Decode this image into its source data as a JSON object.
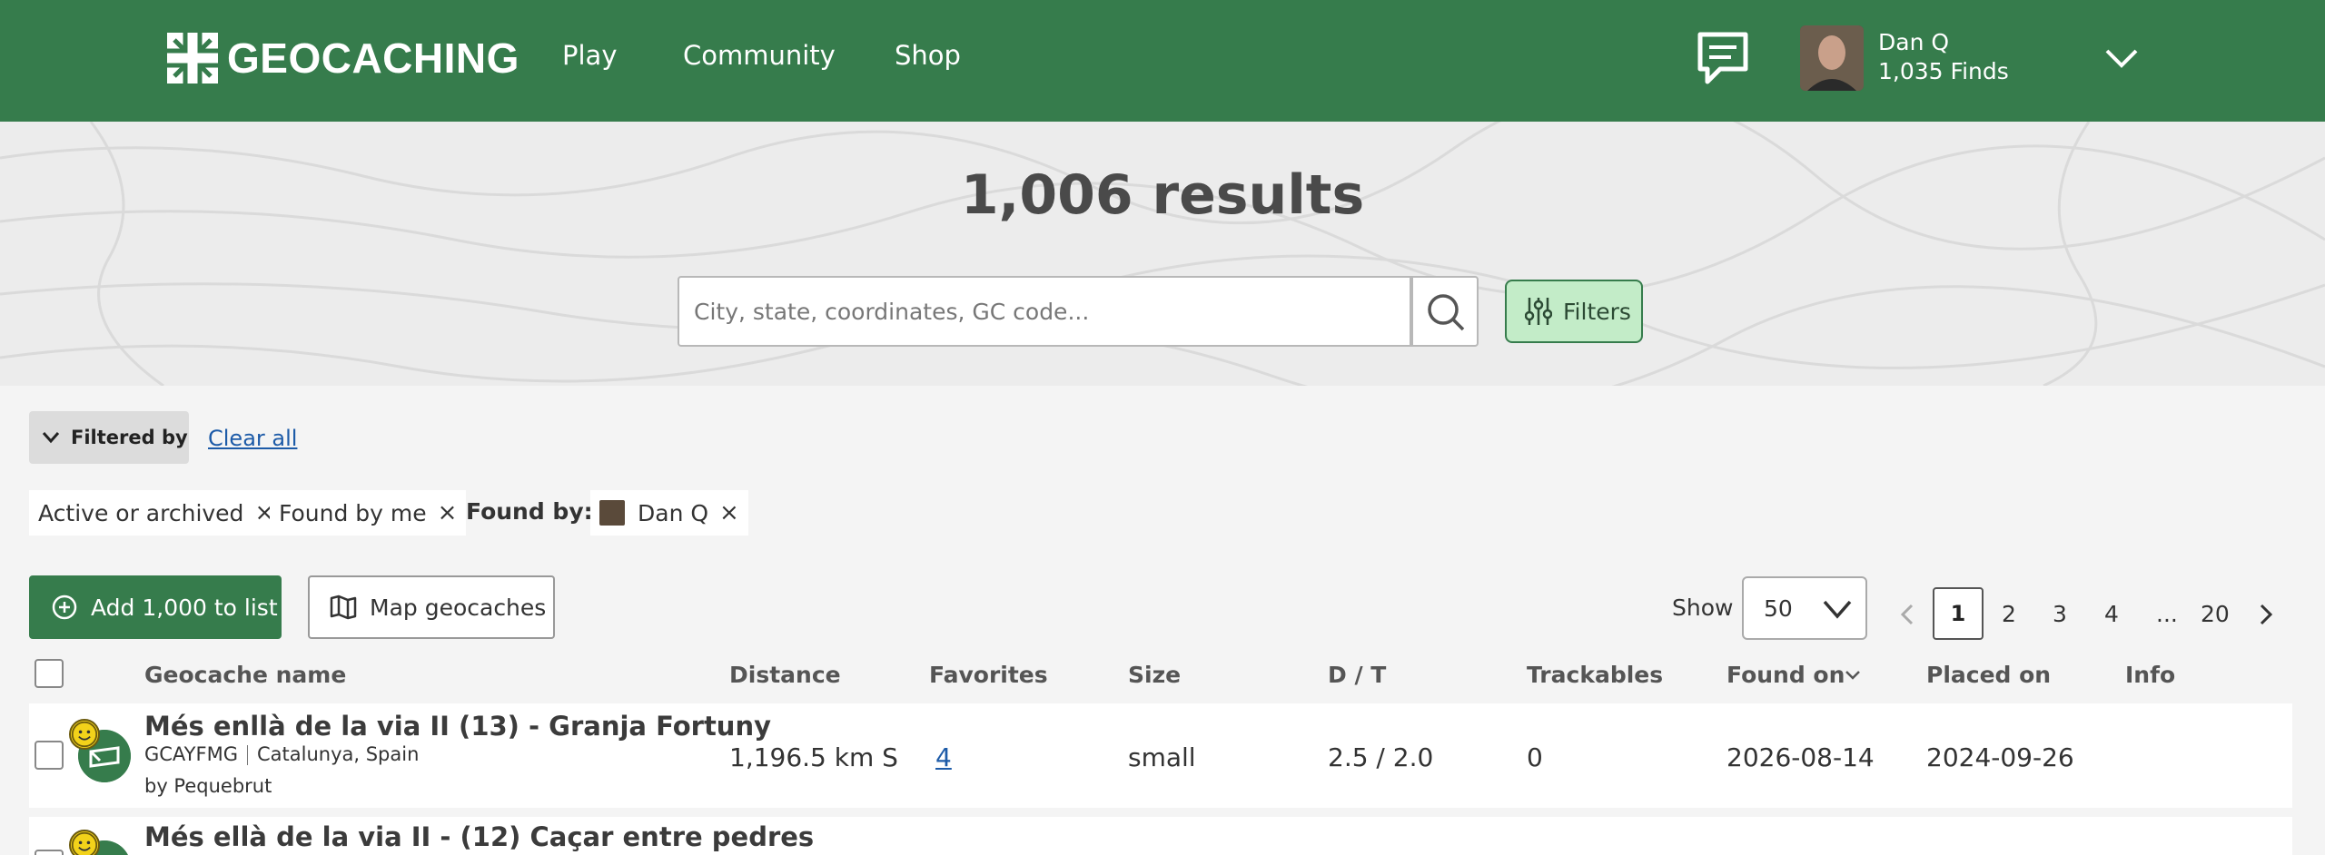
{
  "header": {
    "logo_text": "GEOCACHING",
    "nav": [
      "Play",
      "Community",
      "Shop"
    ],
    "user": {
      "name": "Dan Q",
      "finds": "1,035 Finds"
    },
    "brand_color": "#367c4c"
  },
  "search": {
    "results_title": "1,006 results",
    "placeholder": "City, state, coordinates, GC code...",
    "filters_label": "Filters"
  },
  "filters": {
    "filtered_by_label": "Filtered by",
    "clear_all": "Clear all",
    "chips": [
      "Active or archived",
      "Found by me"
    ],
    "found_by_label": "Found by:",
    "found_by_user": "Dan Q",
    "remove_symbol": "×"
  },
  "toolbar": {
    "add_label": "Add 1,000 to list",
    "map_label": "Map geocaches",
    "show_label": "Show",
    "show_value": "50"
  },
  "pagination": {
    "current": "1",
    "pages": [
      "2",
      "3",
      "4",
      "...",
      "20"
    ]
  },
  "table": {
    "columns": [
      "Geocache name",
      "Distance",
      "Favorites",
      "Size",
      "D / T",
      "Trackables",
      "Found on",
      "Placed on",
      "Info"
    ],
    "rows": [
      {
        "name": "Més enllà de la via II (13) - Granja Fortuny",
        "code": "GCAYFMG",
        "location": "Catalunya, Spain",
        "owner": "by Pequebrut",
        "distance": "1,196.5 km S",
        "favorites": "4",
        "size": "small",
        "dt": "2.5 / 2.0",
        "trackables": "0",
        "found_on": "2026-08-14",
        "placed_on": "2024-09-26"
      },
      {
        "name": "Més ellà de la via II - (12) Caçar entre pedres"
      }
    ]
  }
}
